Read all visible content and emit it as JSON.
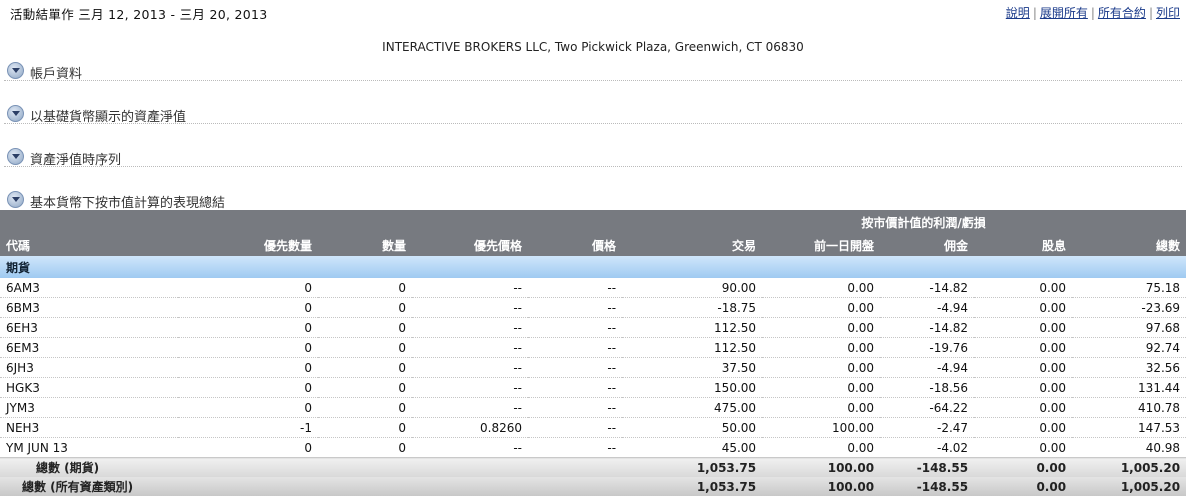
{
  "header": {
    "title": "活動結單作 三月 12, 2013 - 三月 20, 2013",
    "links": [
      "說明",
      "展開所有",
      "所有合約",
      "列印"
    ],
    "broker": "INTERACTIVE BROKERS LLC, Two Pickwick Plaza, Greenwich, CT 06830"
  },
  "sections": [
    {
      "label": "帳戶資料"
    },
    {
      "label": "以基礎貨幣顯示的資產淨值"
    },
    {
      "label": "資產淨值時序列"
    },
    {
      "label": "基本貨幣下按市值計算的表現總結"
    }
  ],
  "table": {
    "group_header": "按市價計值的利潤/虧損",
    "columns": [
      "代碼",
      "優先數量",
      "數量",
      "優先價格",
      "價格",
      "交易",
      "前一日開盤",
      "佣金",
      "股息",
      "總數"
    ],
    "category": "期貨",
    "rows": [
      [
        "6AM3",
        "0",
        "0",
        "--",
        "--",
        "90.00",
        "0.00",
        "-14.82",
        "0.00",
        "75.18"
      ],
      [
        "6BM3",
        "0",
        "0",
        "--",
        "--",
        "-18.75",
        "0.00",
        "-4.94",
        "0.00",
        "-23.69"
      ],
      [
        "6EH3",
        "0",
        "0",
        "--",
        "--",
        "112.50",
        "0.00",
        "-14.82",
        "0.00",
        "97.68"
      ],
      [
        "6EM3",
        "0",
        "0",
        "--",
        "--",
        "112.50",
        "0.00",
        "-19.76",
        "0.00",
        "92.74"
      ],
      [
        "6JH3",
        "0",
        "0",
        "--",
        "--",
        "37.50",
        "0.00",
        "-4.94",
        "0.00",
        "32.56"
      ],
      [
        "HGK3",
        "0",
        "0",
        "--",
        "--",
        "150.00",
        "0.00",
        "-18.56",
        "0.00",
        "131.44"
      ],
      [
        "JYM3",
        "0",
        "0",
        "--",
        "--",
        "475.00",
        "0.00",
        "-64.22",
        "0.00",
        "410.78"
      ],
      [
        "NEH3",
        "-1",
        "0",
        "0.8260",
        "--",
        "50.00",
        "100.00",
        "-2.47",
        "0.00",
        "147.53"
      ],
      [
        "YM JUN 13",
        "0",
        "0",
        "--",
        "--",
        "45.00",
        "0.00",
        "-4.02",
        "0.00",
        "40.98"
      ]
    ],
    "totals": [
      [
        "總數 (期貨)",
        "1,053.75",
        "100.00",
        "-148.55",
        "0.00",
        "1,005.20"
      ],
      [
        "總數 (所有資產類別)",
        "1,053.75",
        "100.00",
        "-148.55",
        "0.00",
        "1,005.20"
      ]
    ]
  }
}
